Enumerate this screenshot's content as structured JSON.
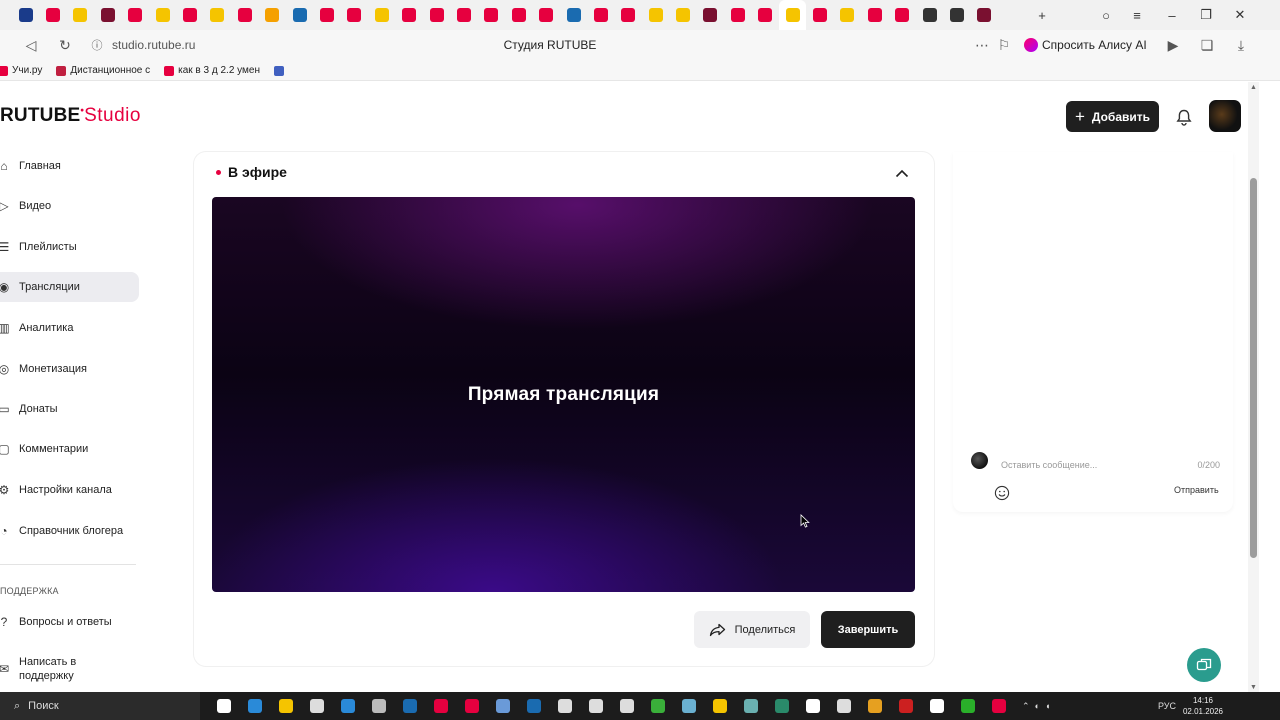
{
  "browser": {
    "tab_colors": [
      "#1a3b8a",
      "#e6003f",
      "#f5c400",
      "#7a1030",
      "#e6003f",
      "#f5c400",
      "#e6003f",
      "#f5c400",
      "#e6003f",
      "#f5a000",
      "#1a6bb0",
      "#e6003f",
      "#e6003f",
      "#f5c400",
      "#e6003f",
      "#e6003f",
      "#e6003f",
      "#e6003f",
      "#e6003f",
      "#e6003f",
      "#1a6bb0",
      "#e6003f",
      "#e6003f",
      "#f5c400",
      "#f5c400",
      "#7a1030",
      "#e6003f",
      "#e6003f",
      "#f5c400",
      "#e6003f",
      "#f5c400",
      "#e6003f",
      "#e6003f",
      "#333333",
      "#333333",
      "#7a1030"
    ],
    "url": "studio.rutube.ru",
    "page_title": "Студия RUTUBE",
    "alice_label": "Спросить Алису AI",
    "bookmarks": [
      {
        "label": "Учи.ру",
        "color": "#e6003f"
      },
      {
        "label": "Дистанционное с",
        "color": "#c02040"
      },
      {
        "label": "как в 3 д 2.2 умен",
        "color": "#e6003f"
      },
      {
        "label": "",
        "color": "#4060c0"
      }
    ]
  },
  "header": {
    "logo_main": "RUTUBE",
    "logo_studio": "Studio",
    "add_button": "Добавить"
  },
  "sidebar": {
    "items": [
      {
        "label": "Главная",
        "icon": "home-icon",
        "glyph": "⌂"
      },
      {
        "label": "Видео",
        "icon": "video-icon",
        "glyph": "▷"
      },
      {
        "label": "Плейлисты",
        "icon": "playlist-icon",
        "glyph": "☰"
      },
      {
        "label": "Трансляции",
        "icon": "broadcast-icon",
        "glyph": "◉",
        "active": true
      },
      {
        "label": "Аналитика",
        "icon": "analytics-icon",
        "glyph": "▥"
      },
      {
        "label": "Монетизация",
        "icon": "monetization-icon",
        "glyph": "◎"
      },
      {
        "label": "Донаты",
        "icon": "donate-icon",
        "glyph": "▭"
      },
      {
        "label": "Комментарии",
        "icon": "comments-icon",
        "glyph": "▢"
      },
      {
        "label": "Настройки канала",
        "icon": "gear-icon",
        "glyph": "⚙"
      },
      {
        "label": "Справочник блогера",
        "icon": "handbook-icon",
        "glyph": "◔"
      }
    ],
    "support_heading": "ПОДДЕРЖКА",
    "support_items": [
      {
        "label": "Вопросы и ответы",
        "icon": "help-icon",
        "glyph": "?"
      },
      {
        "label": "Написать в поддержку",
        "icon": "mail-icon",
        "glyph": "✉"
      }
    ]
  },
  "live": {
    "status": "В эфире",
    "player_title": "Прямая трансляция",
    "share_button": "Поделиться",
    "finish_button": "Завершить"
  },
  "chat": {
    "placeholder": "Оставить сообщение...",
    "counter": "0/200",
    "send": "Отправить"
  },
  "taskbar": {
    "search": "Поиск",
    "icon_colors": [
      "#ffffff",
      "#2a8ad8",
      "#f5c400",
      "#dddddd",
      "#2a8ad8",
      "#bbbbbb",
      "#1a6bb0",
      "#e6003f",
      "#e6003f",
      "#6a9ad8",
      "#1a6bb0",
      "#dddddd",
      "#dddddd",
      "#dddddd",
      "#3ab03a",
      "#6ab0d0",
      "#f5c400",
      "#6ab0b0",
      "#2a8a6a",
      "#ffffff",
      "#dddddd",
      "#e6a020",
      "#cc2020",
      "#ffffff",
      "#2ab02a",
      "#e6003f"
    ],
    "language": "РУС",
    "time": "14:16",
    "date": "02.01.2026"
  },
  "colors": {
    "accent": "#e6003f",
    "dark_button": "#1f1f1f",
    "help_fab": "#2a9c8e"
  }
}
